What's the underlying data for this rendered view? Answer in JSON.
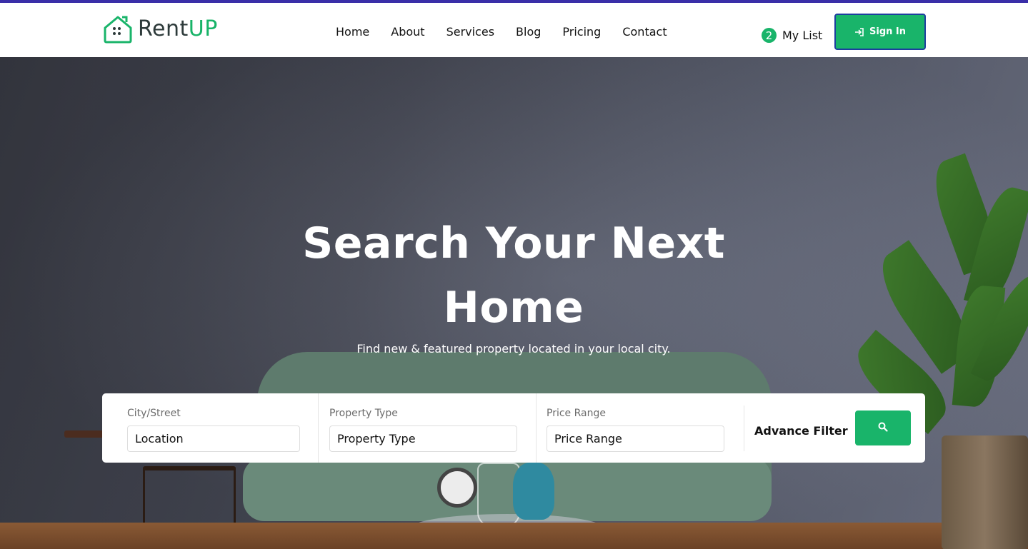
{
  "brand": {
    "name_part1": "Rent",
    "name_part2": "UP",
    "logo_icon": "house-logo-icon",
    "accent_color": "#19b46a",
    "topbar_color": "#3a2ea8"
  },
  "nav": {
    "items": [
      {
        "label": "Home"
      },
      {
        "label": "About"
      },
      {
        "label": "Services"
      },
      {
        "label": "Blog"
      },
      {
        "label": "Pricing"
      },
      {
        "label": "Contact"
      }
    ]
  },
  "header": {
    "my_list_count": "2",
    "my_list_label": "My List",
    "signin_label": "Sign In",
    "signin_icon": "sign-in-icon"
  },
  "hero": {
    "title_line1": "Search Your Next",
    "title_line2": "Home",
    "subtitle": "Find new & featured property located in your local city."
  },
  "search": {
    "city": {
      "label": "City/Street",
      "value": "Location"
    },
    "type": {
      "label": "Property Type",
      "value": "Property Type"
    },
    "price": {
      "label": "Price Range",
      "value": "Price Range"
    },
    "advance_filter_label": "Advance Filter",
    "search_icon": "search-icon"
  }
}
